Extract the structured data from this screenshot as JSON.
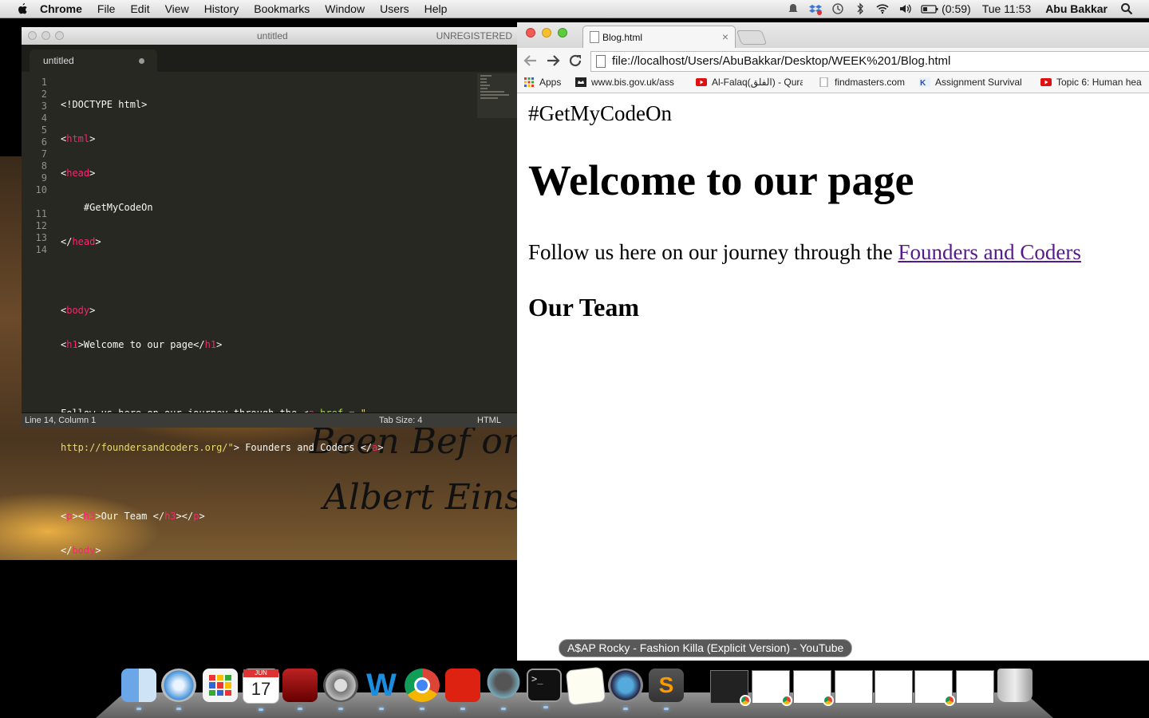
{
  "menubar": {
    "app": "Chrome",
    "menus": [
      "File",
      "Edit",
      "View",
      "History",
      "Bookmarks",
      "Window",
      "Users",
      "Help"
    ],
    "battery": "(0:59)",
    "clock": "Tue 11:53",
    "user": "Abu Bakkar"
  },
  "wallpaper": {
    "quote_line1": "Been Bef ore",
    "quote_line2": "Albert Einst"
  },
  "editor": {
    "window_title": "untitled",
    "unregistered": "UNREGISTERED",
    "tab_label": "untitled",
    "line_numbers": [
      "1",
      "2",
      "3",
      "4",
      "5",
      "6",
      "7",
      "8",
      "9",
      "10",
      "",
      "11",
      "12",
      "13",
      "14"
    ],
    "status_position": "Line 14, Column 1",
    "status_tabsize": "Tab Size: 4",
    "status_syntax": "HTML"
  },
  "browser": {
    "tab_title": "Blog.html",
    "tab_close": "×",
    "url": "file://localhost/Users/AbuBakkar/Desktop/WEEK%201/Blog.html",
    "bookmarks": [
      {
        "label": "Apps"
      },
      {
        "label": "www.bis.gov.uk/ass"
      },
      {
        "label": "Al-Falaq(الفلق) - Qura"
      },
      {
        "label": "findmasters.com"
      },
      {
        "label": "Assignment Survival"
      },
      {
        "label": "Topic 6: Human hea"
      }
    ],
    "page": {
      "head_text": "#GetMyCodeOn",
      "h1": "Welcome to our page",
      "paragraph": "Follow us here on our journey through the ",
      "link": "Founders and Coders",
      "h3": "Our Team"
    }
  },
  "dock": {
    "tooltip": "A$AP Rocky - Fashion Killa (Explicit Version) - YouTube",
    "calendar_day": "17",
    "calendar_month": "JUN"
  }
}
